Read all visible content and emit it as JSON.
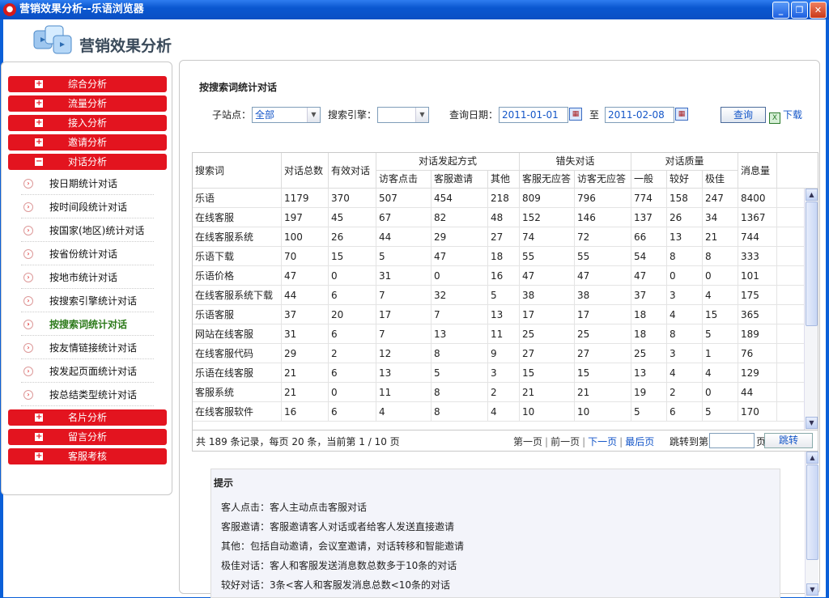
{
  "window": {
    "title": "营销效果分析--乐语浏览器",
    "minimize_icon": "minimize-icon",
    "restore_icon": "restore-icon",
    "close_icon": "close-icon"
  },
  "brand": {
    "title": "营销效果分析"
  },
  "sidebar": {
    "top_nav": [
      "综合分析",
      "流量分析",
      "接入分析",
      "邀请分析"
    ],
    "active_group": "对话分析",
    "sub_items": [
      "按日期统计对话",
      "按时间段统计对话",
      "按国家(地区)统计对话",
      "按省份统计对话",
      "按地市统计对话",
      "按搜索引擎统计对话",
      "按搜索词统计对话",
      "按友情链接统计对话",
      "按发起页面统计对话",
      "按总结类型统计对话"
    ],
    "active_sub": "按搜索词统计对话",
    "bottom_nav": [
      "名片分析",
      "留言分析",
      "客服考核"
    ]
  },
  "filters": {
    "title": "按搜索词统计对话",
    "site_label": "子站点：",
    "site_value": "全部",
    "engine_label": "搜索引擎：",
    "engine_value": "",
    "date_label": "查询日期：",
    "date_from": "2011-01-01",
    "date_to_label": "至",
    "date_to": "2011-02-08",
    "query_button": "查询",
    "download_link": "下载"
  },
  "table": {
    "headers": {
      "keyword": "搜索词",
      "total": "对话总数",
      "valid": "有效对话",
      "initiation_group": "对话发起方式",
      "visitor_click": "访客点击",
      "agent_invite": "客服邀请",
      "other": "其他",
      "missed_group": "错失对话",
      "agent_no_answer": "客服无应答",
      "visitor_no_answer": "访客无应答",
      "quality_group": "对话质量",
      "normal": "一般",
      "good": "较好",
      "best": "极佳",
      "messages": "消息量"
    },
    "rows": [
      [
        "乐语",
        "1179",
        "370",
        "507",
        "454",
        "218",
        "809",
        "796",
        "774",
        "158",
        "247",
        "8400"
      ],
      [
        "在线客服",
        "197",
        "45",
        "67",
        "82",
        "48",
        "152",
        "146",
        "137",
        "26",
        "34",
        "1367"
      ],
      [
        "在线客服系统",
        "100",
        "26",
        "44",
        "29",
        "27",
        "74",
        "72",
        "66",
        "13",
        "21",
        "744"
      ],
      [
        "乐语下载",
        "70",
        "15",
        "5",
        "47",
        "18",
        "55",
        "55",
        "54",
        "8",
        "8",
        "333"
      ],
      [
        "乐语价格",
        "47",
        "0",
        "31",
        "0",
        "16",
        "47",
        "47",
        "47",
        "0",
        "0",
        "101"
      ],
      [
        "在线客服系统下载",
        "44",
        "6",
        "7",
        "32",
        "5",
        "38",
        "38",
        "37",
        "3",
        "4",
        "175"
      ],
      [
        "乐语客服",
        "37",
        "20",
        "17",
        "7",
        "13",
        "17",
        "17",
        "18",
        "4",
        "15",
        "365"
      ],
      [
        "网站在线客服",
        "31",
        "6",
        "7",
        "13",
        "11",
        "25",
        "25",
        "18",
        "8",
        "5",
        "189"
      ],
      [
        "在线客服代码",
        "29",
        "2",
        "12",
        "8",
        "9",
        "27",
        "27",
        "25",
        "3",
        "1",
        "76"
      ],
      [
        "乐语在线客服",
        "21",
        "6",
        "13",
        "5",
        "3",
        "15",
        "15",
        "13",
        "4",
        "4",
        "129"
      ],
      [
        "客服系统",
        "21",
        "0",
        "11",
        "8",
        "2",
        "21",
        "21",
        "19",
        "2",
        "0",
        "44"
      ],
      [
        "在线客服软件",
        "16",
        "6",
        "4",
        "8",
        "4",
        "10",
        "10",
        "5",
        "6",
        "5",
        "170"
      ]
    ]
  },
  "pager": {
    "info": "共 189 条记录，每页 20 条，当前第 1 / 10 页",
    "first": "第一页",
    "prev": "前一页",
    "next": "下一页",
    "last": "最后页",
    "jump_label": "跳转到第",
    "page_unit": "页",
    "jump_button": "跳转"
  },
  "tips": {
    "title": "提示",
    "lines": [
      "客人点击：客人主动点击客服对话",
      "客服邀请：客服邀请客人对话或者给客人发送直接邀请",
      "其他：包括自动邀请，会议室邀请，对话转移和智能邀请",
      "极佳对话：客人和客服发送消息数总数多于10条的对话",
      "较好对话：3条<客人和客服发消息总数<10条的对话"
    ]
  }
}
